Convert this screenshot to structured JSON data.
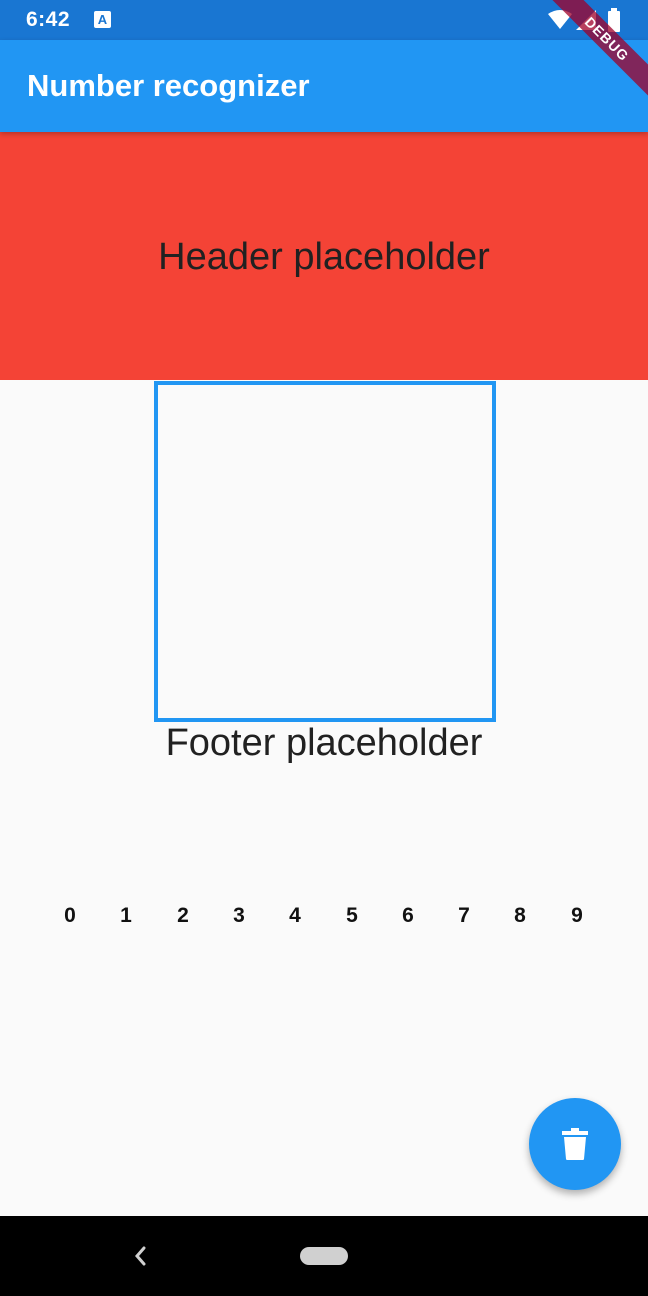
{
  "status_bar": {
    "time": "6:42",
    "notification_icon_letter": "A",
    "icons": [
      "a-notification-icon",
      "wifi-icon",
      "signal-icon",
      "battery-icon"
    ]
  },
  "app_bar": {
    "title": "Number recognizer",
    "debug_banner": "DEBUG",
    "color": "#2196f3"
  },
  "header": {
    "text": "Header placeholder",
    "color": "#f44336"
  },
  "canvas": {
    "border_color": "#2196f3"
  },
  "footer": {
    "text": "Footer placeholder"
  },
  "digits": [
    "0",
    "1",
    "2",
    "3",
    "4",
    "5",
    "6",
    "7",
    "8",
    "9"
  ],
  "fab": {
    "icon": "trash-icon",
    "color": "#2196f3"
  },
  "nav_bar": {
    "icons": [
      "back-icon",
      "home-pill"
    ]
  }
}
